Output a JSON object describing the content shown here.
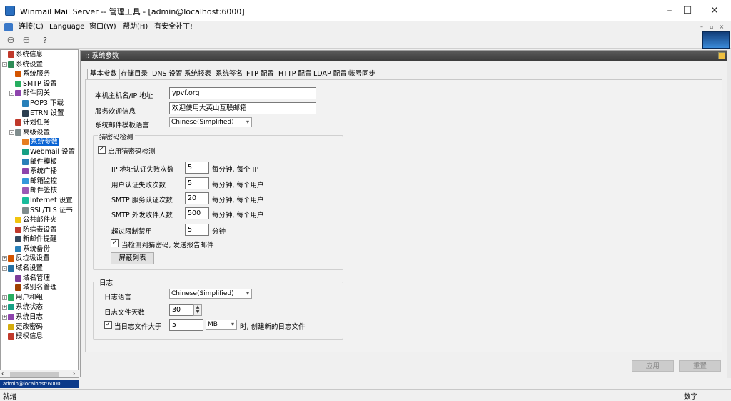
{
  "window": {
    "title": "Winmail Mail Server -- 管理工具 - [admin@localhost:6000]",
    "min_icon": "minimize-icon",
    "max_icon": "maximize-icon",
    "close_icon": "close-icon"
  },
  "menu": [
    "连接(C)",
    "Language",
    "窗口(W)",
    "帮助(H)",
    "有安全补丁!"
  ],
  "mdi_controls": [
    "–",
    "▫",
    "×"
  ],
  "tree": [
    {
      "label": "系统信息",
      "level": 0,
      "exp": "",
      "color": "#c0392b"
    },
    {
      "label": "系统设置",
      "level": 0,
      "exp": "-",
      "color": "#2e8b57"
    },
    {
      "label": "系统服务",
      "level": 1,
      "exp": "",
      "color": "#d35400"
    },
    {
      "label": "SMTP 设置",
      "level": 1,
      "exp": "",
      "color": "#27ae60"
    },
    {
      "label": "邮件网关",
      "level": 1,
      "exp": "-",
      "color": "#8e44ad"
    },
    {
      "label": "POP3 下载",
      "level": 2,
      "exp": "",
      "color": "#2980b9"
    },
    {
      "label": "ETRN 设置",
      "level": 2,
      "exp": "",
      "color": "#2c3e50"
    },
    {
      "label": "计划任务",
      "level": 1,
      "exp": "",
      "color": "#c0392b"
    },
    {
      "label": "高级设置",
      "level": 1,
      "exp": "-",
      "color": "#7f8c8d"
    },
    {
      "label": "系统参数",
      "level": 2,
      "exp": "",
      "color": "#e67e22",
      "selected": true
    },
    {
      "label": "Webmail 设置",
      "level": 2,
      "exp": "",
      "color": "#16a085"
    },
    {
      "label": "邮件模板",
      "level": 2,
      "exp": "",
      "color": "#2980b9"
    },
    {
      "label": "系统广播",
      "level": 2,
      "exp": "",
      "color": "#8e44ad"
    },
    {
      "label": "邮箱监控",
      "level": 2,
      "exp": "",
      "color": "#3498db"
    },
    {
      "label": "邮件签核",
      "level": 2,
      "exp": "",
      "color": "#9b59b6"
    },
    {
      "label": "Internet 设置",
      "level": 2,
      "exp": "",
      "color": "#1abc9c"
    },
    {
      "label": "SSL/TLS 证书",
      "level": 2,
      "exp": "",
      "color": "#7f8c8d"
    },
    {
      "label": "公共邮件夹",
      "level": 1,
      "exp": "",
      "color": "#f1c40f"
    },
    {
      "label": "防病毒设置",
      "level": 1,
      "exp": "",
      "color": "#c0392b"
    },
    {
      "label": "新邮件提醒",
      "level": 1,
      "exp": "",
      "color": "#34495e"
    },
    {
      "label": "系统备份",
      "level": 1,
      "exp": "",
      "color": "#2980b9"
    },
    {
      "label": "反垃圾设置",
      "level": 0,
      "exp": "+",
      "color": "#d35400"
    },
    {
      "label": "域名设置",
      "level": 0,
      "exp": "-",
      "color": "#2471a3"
    },
    {
      "label": "域名管理",
      "level": 1,
      "exp": "",
      "color": "#7d3c98"
    },
    {
      "label": "域别名管理",
      "level": 1,
      "exp": "",
      "color": "#a04000"
    },
    {
      "label": "用户和组",
      "level": 0,
      "exp": "+",
      "color": "#27ae60"
    },
    {
      "label": "系统状态",
      "level": 0,
      "exp": "+",
      "color": "#16a085"
    },
    {
      "label": "系统日志",
      "level": 0,
      "exp": "+",
      "color": "#8e44ad"
    },
    {
      "label": "更改密码",
      "level": 0,
      "exp": "",
      "color": "#d4ac0d"
    },
    {
      "label": "授权信息",
      "level": 0,
      "exp": "",
      "color": "#c0392b"
    }
  ],
  "status_left": "admin@localhost:6000",
  "statusbar": {
    "left": "就绪",
    "right": "数字"
  },
  "panel": {
    "title": ":: 系统参数",
    "tabs": [
      "基本参数",
      "存储目录",
      "DNS 设置",
      "系统报表",
      "系统签名",
      "FTP 配置",
      "HTTP 配置",
      "LDAP 配置",
      "帐号同步"
    ],
    "hostname_label": "本机主机名/IP 地址",
    "hostname_value": "ypvf.org",
    "welcome_label": "服务欢迎信息",
    "welcome_value": "欢迎使用大英山互联邮箱",
    "template_lang_label": "系统邮件模板语言",
    "template_lang_value": "Chinese(Simplified)",
    "guess_group": "猜密码检测",
    "enable_guess": "启用猜密码检测",
    "rows": [
      {
        "label": "IP 地址认证失败次数",
        "value": "5",
        "suffix": "每分钟, 每个 IP"
      },
      {
        "label": "用户认证失败次数",
        "value": "5",
        "suffix": "每分钟, 每个用户"
      },
      {
        "label": "SMTP 服务认证次数",
        "value": "20",
        "suffix": "每分钟, 每个用户"
      },
      {
        "label": "SMTP 外发收件人数",
        "value": "500",
        "suffix": "每分钟, 每个用户"
      },
      {
        "label": "超过限制禁用",
        "value": "5",
        "suffix": "分钟"
      }
    ],
    "report_check": "当检测到猜密码, 发送报告邮件",
    "block_list_btn": "屏蔽列表",
    "log_group": "日志",
    "log_lang_label": "日志语言",
    "log_lang_value": "Chinese(Simplified)",
    "log_days_label": "日志文件天数",
    "log_days_value": "30",
    "log_size_check": "当日志文件大于",
    "log_size_value": "5",
    "log_unit": "MB",
    "log_size_suffix": "时, 创建新的日志文件",
    "apply_btn": "应用",
    "reset_btn": "重置"
  }
}
